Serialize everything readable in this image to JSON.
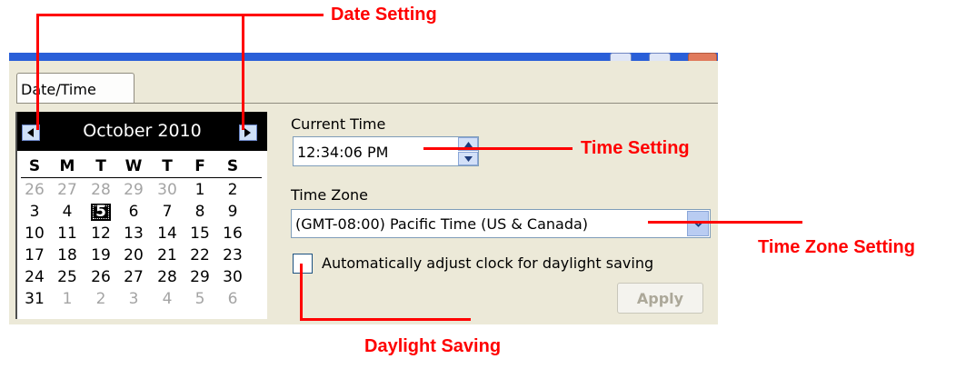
{
  "window": {
    "tab_label": "Date/Time"
  },
  "calendar": {
    "month_title": "October 2010",
    "prev_icon": "left-arrow-icon",
    "next_icon": "right-arrow-icon",
    "weekdays": [
      "S",
      "M",
      "T",
      "W",
      "T",
      "F",
      "S"
    ],
    "weeks": [
      [
        "26",
        "27",
        "28",
        "29",
        "30",
        "1",
        "2"
      ],
      [
        "3",
        "4",
        "5",
        "6",
        "7",
        "8",
        "9"
      ],
      [
        "10",
        "11",
        "12",
        "13",
        "14",
        "15",
        "16"
      ],
      [
        "17",
        "18",
        "19",
        "20",
        "21",
        "22",
        "23"
      ],
      [
        "24",
        "25",
        "26",
        "27",
        "28",
        "29",
        "30"
      ],
      [
        "31",
        "1",
        "2",
        "3",
        "4",
        "5",
        "6"
      ]
    ],
    "selected_day": "5"
  },
  "time": {
    "label": "Current Time",
    "value": "12:34:06 PM"
  },
  "timezone": {
    "label": "Time Zone",
    "value": "(GMT-08:00) Pacific Time (US & Canada)"
  },
  "daylight": {
    "label": "Automatically adjust clock for daylight saving",
    "checked": false
  },
  "apply": {
    "label": "Apply"
  },
  "annotations": {
    "date_setting": "Date Setting",
    "time_setting": "Time Setting",
    "timezone_setting": "Time Zone Setting",
    "daylight_saving": "Daylight Saving"
  },
  "colors": {
    "annotation": "#ff0000",
    "dialog_bg": "#ece9d8",
    "title_bar": "#2a5fd8"
  }
}
